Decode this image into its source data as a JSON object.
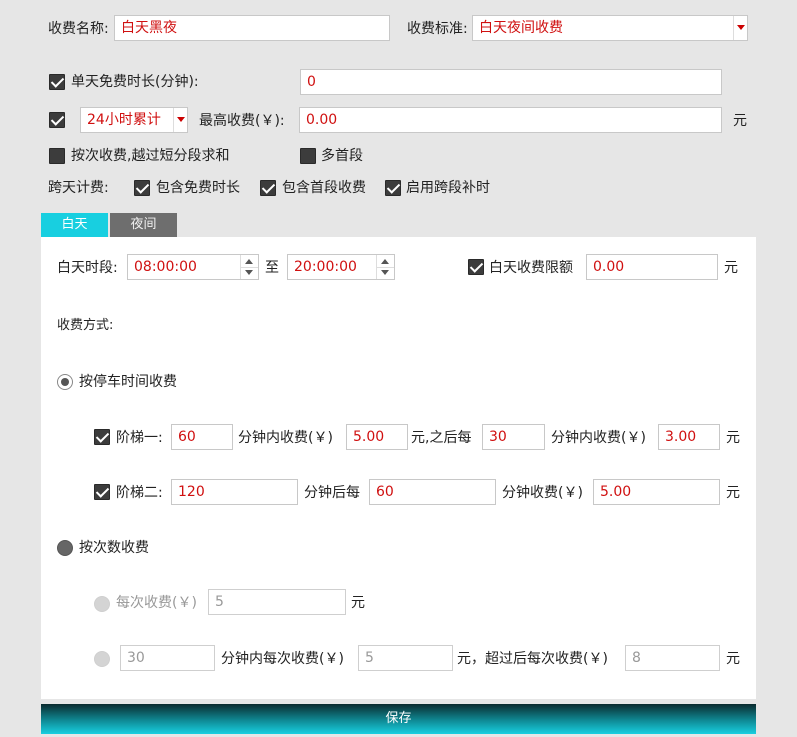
{
  "top": {
    "name_label": "收费名称:",
    "name_value": "白天黑夜",
    "standard_label": "收费标准:",
    "standard_value": "白天夜间收费",
    "free_duration_label": "单天免费时长(分钟):",
    "free_duration_value": "0",
    "mode_value": "24小时累计",
    "max_fee_label": "最高收费(￥):",
    "max_fee_value": "0.00",
    "yuan": "元",
    "per_time_label": "按次收费,越过短分段求和",
    "multi_first_label": "多首段",
    "cross_day_label": "跨天计费:",
    "include_free_label": "包含免费时长",
    "include_first_label": "包含首段收费",
    "enable_cross_label": "启用跨段补时"
  },
  "tabs": [
    {
      "label": "白天",
      "active": true
    },
    {
      "label": "夜间",
      "active": false
    }
  ],
  "day": {
    "period_label": "白天时段:",
    "start": "08:00:00",
    "to": "至",
    "end": "20:00:00",
    "limit_label": "白天收费限额",
    "limit_value": "0.00",
    "yuan": "元",
    "method_label": "收费方式:",
    "by_time_label": "按停车时间收费",
    "tier1": {
      "label": "阶梯一:",
      "minutes": "60",
      "within_label": "分钟内收费(￥)",
      "fee": "5.00",
      "after_label": "元,之后每",
      "every": "30",
      "within2_label": "分钟内收费(￥)",
      "fee2": "3.00",
      "yuan": "元"
    },
    "tier2": {
      "label": "阶梯二:",
      "minutes": "120",
      "after_label": "分钟后每",
      "every": "60",
      "fee_label": "分钟收费(￥)",
      "fee": "5.00",
      "yuan": "元"
    },
    "by_count_label": "按次数收费",
    "per_count": {
      "label": "每次收费(￥)",
      "value": "5",
      "yuan": "元"
    },
    "count_mixed": {
      "minutes": "30",
      "within_label": "分钟内每次收费(￥)",
      "fee": "5",
      "yuan_after": "元，超过后每次收费(￥)",
      "fee2": "8",
      "yuan": "元"
    }
  },
  "save_label": "保存"
}
